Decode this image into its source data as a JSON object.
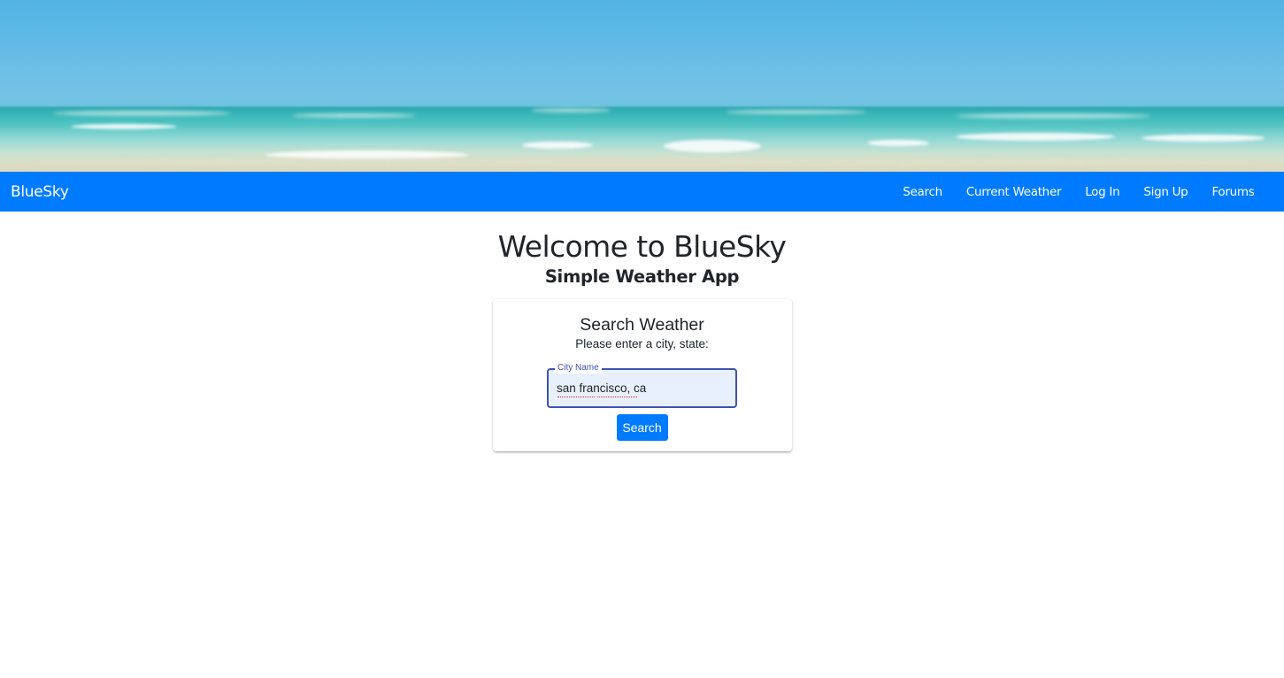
{
  "navbar": {
    "brand": "BlueSky",
    "links": [
      {
        "label": "Search"
      },
      {
        "label": "Current Weather"
      },
      {
        "label": "Log In"
      },
      {
        "label": "Sign Up"
      },
      {
        "label": "Forums"
      }
    ],
    "background_color": "#007bff"
  },
  "main": {
    "title": "Welcome to BlueSky",
    "subtitle": "Simple Weather App"
  },
  "search_card": {
    "title": "Search Weather",
    "subtitle": "Please enter a city, state:",
    "field_label": "City Name",
    "field_value": "san francisco, ca",
    "button_label": "Search"
  },
  "colors": {
    "accent": "#007bff",
    "field_outline": "#3f51b5",
    "field_fill": "#e8f0fe"
  }
}
